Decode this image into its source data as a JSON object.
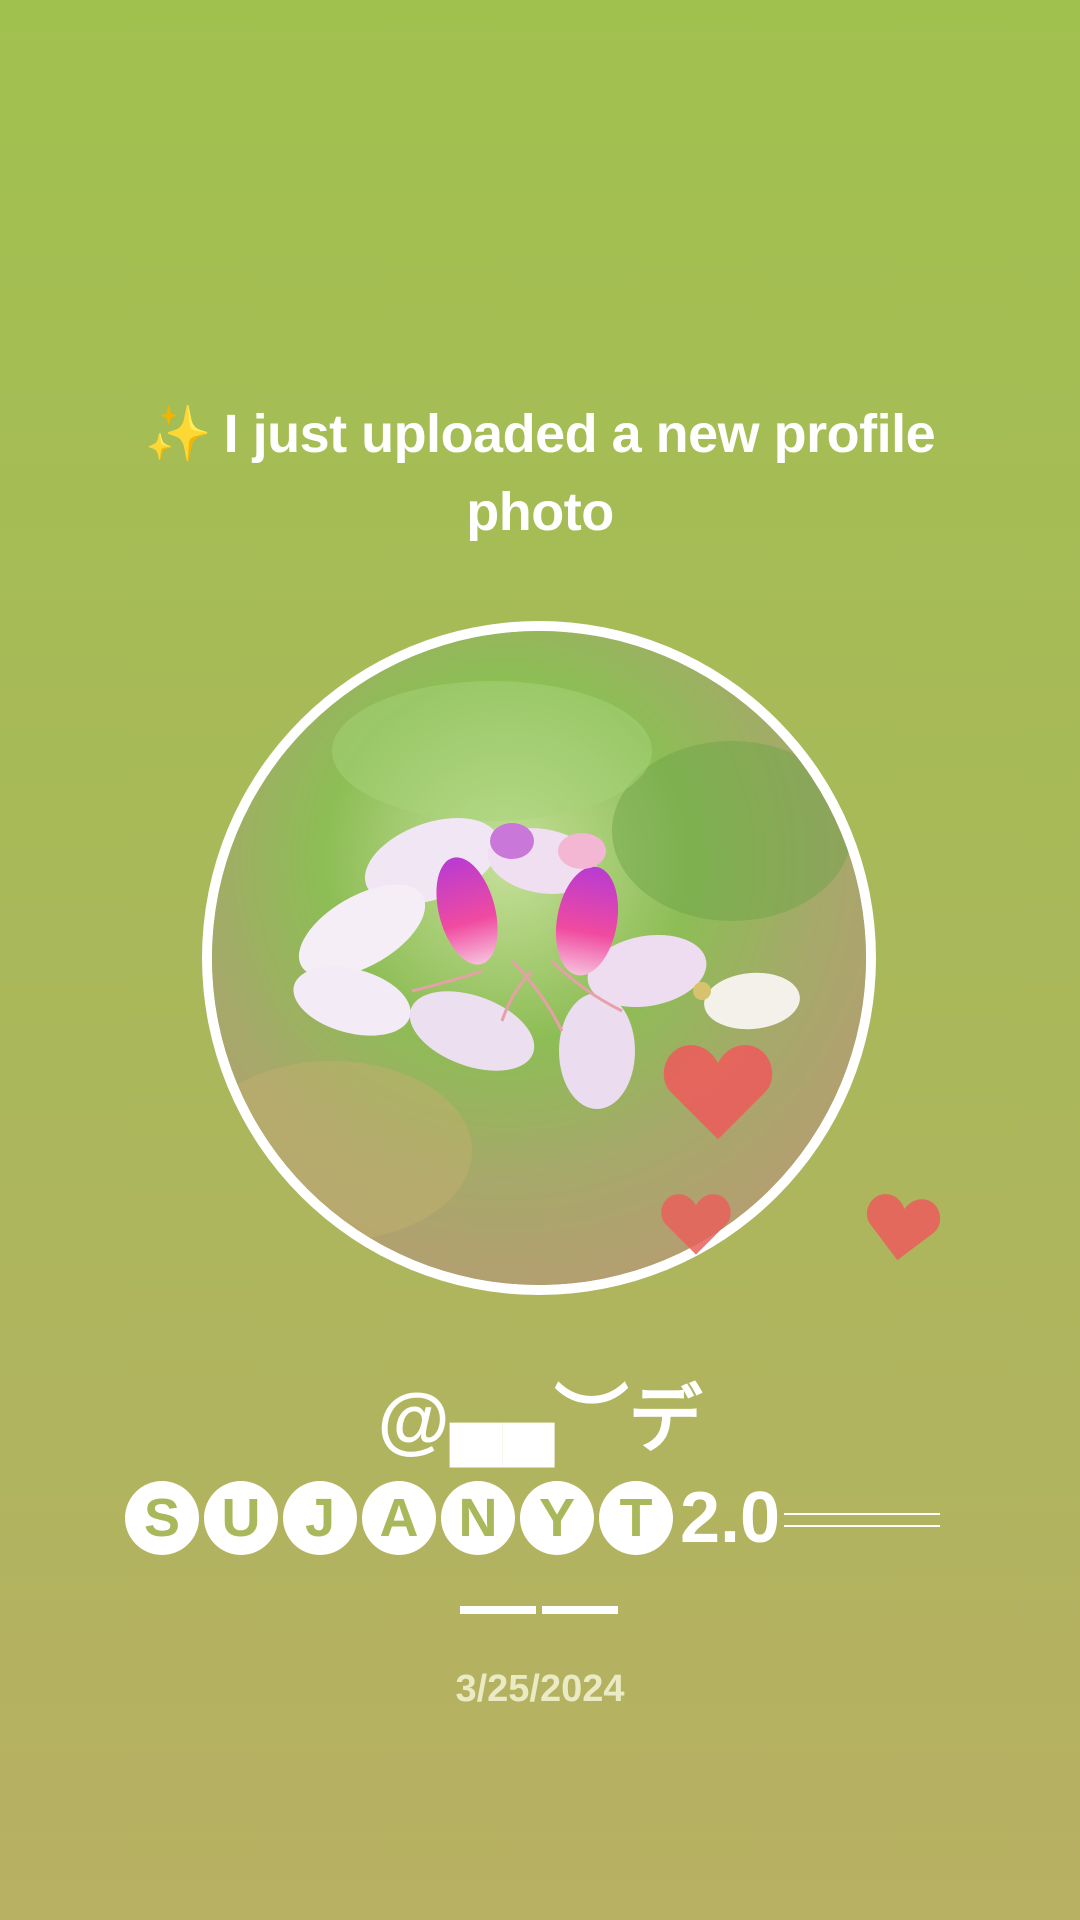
{
  "story": {
    "sparkle_icon": "✨",
    "headline": "I just uploaded a new profile photo",
    "username_line1": "@▄▄︶デ",
    "username_circled_letters": [
      "S",
      "U",
      "J",
      "A",
      "N",
      "Y",
      "T"
    ],
    "username_suffix": "2.0",
    "date": "3/25/2024"
  },
  "icons": {
    "hearts": [
      "heart-icon",
      "heart-icon",
      "heart-icon"
    ],
    "sparkle": "sparkles-icon"
  },
  "colors": {
    "background_top": "#a1c14f",
    "background_bottom": "#b8b063",
    "heart": "#e9605c",
    "text": "#ffffff",
    "date_text": "#eaeac4"
  }
}
